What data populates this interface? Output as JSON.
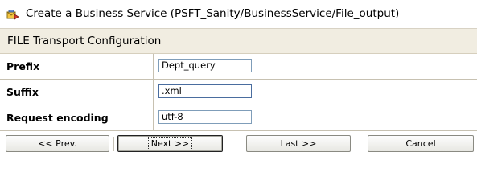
{
  "window": {
    "title": "Create a Business Service (PSFT_Sanity/BusinessService/File_output)",
    "icon": "business-service-icon"
  },
  "section": {
    "title": "FILE Transport Configuration"
  },
  "form": {
    "fields": [
      {
        "label": "Prefix",
        "value": "Dept_query"
      },
      {
        "label": "Suffix",
        "value": ".xml"
      },
      {
        "label": "Request encoding",
        "value": "utf-8"
      }
    ]
  },
  "buttons": {
    "prev": "<< Prev.",
    "next": "Next >>",
    "last": "Last >>",
    "cancel": "Cancel"
  },
  "colors": {
    "header_bg": "#f1ede1",
    "border": "#c7c1b1",
    "input_border": "#7f9db9"
  }
}
